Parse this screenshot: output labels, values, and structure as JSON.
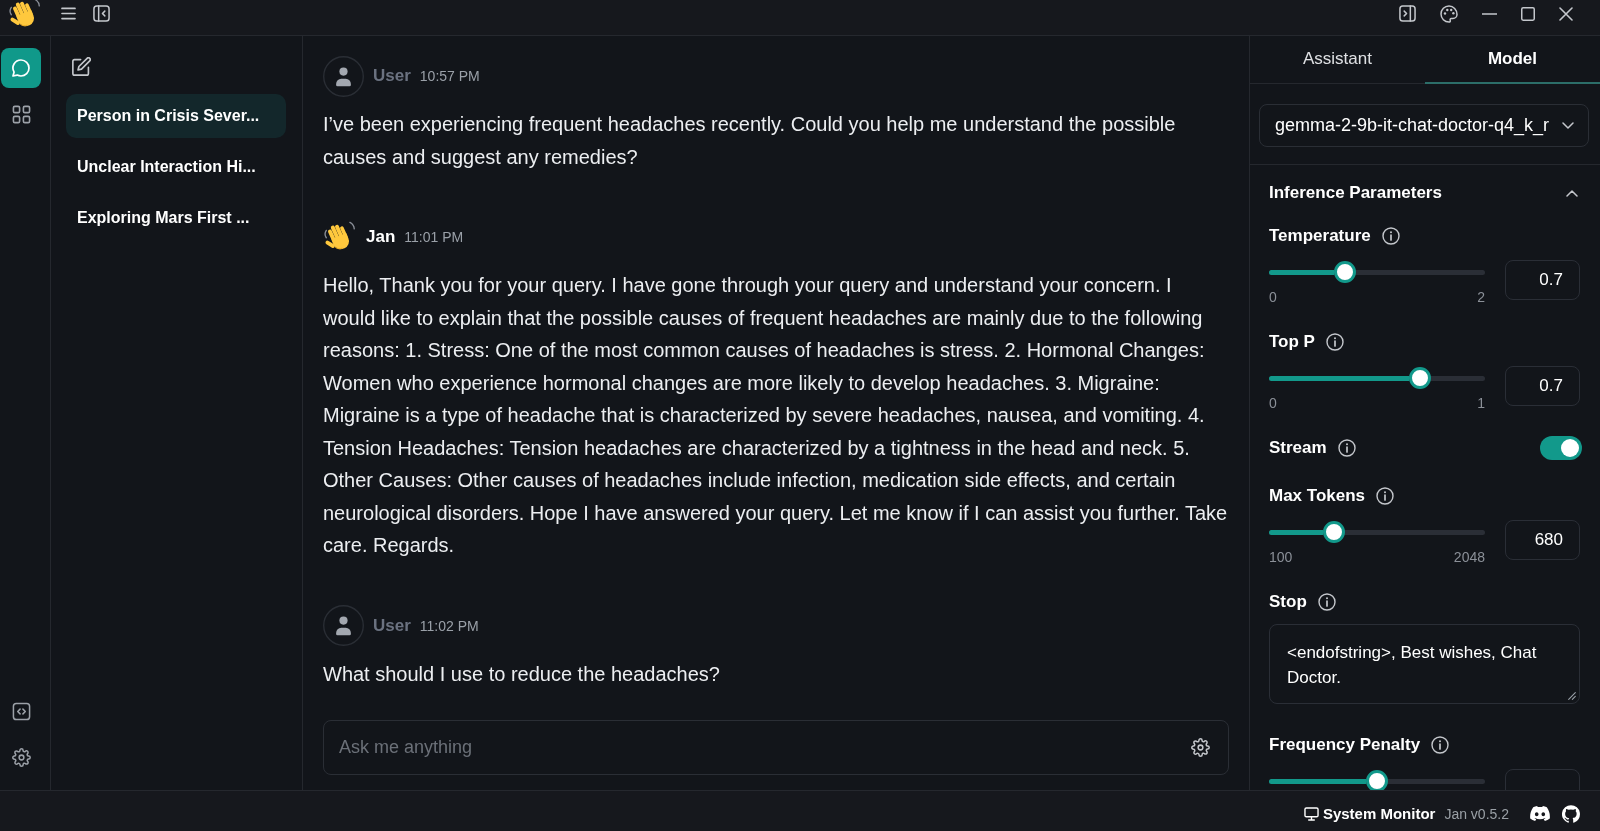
{
  "nav_rail": {
    "items": [
      {
        "kind": "chat",
        "selected": true
      },
      {
        "kind": "hub",
        "selected": false
      }
    ]
  },
  "threads": {
    "items": [
      {
        "title": "Person in Crisis Sever...",
        "selected": true
      },
      {
        "title": "Unclear Interaction Hi...",
        "selected": false
      },
      {
        "title": "Exploring Mars First ...",
        "selected": false
      }
    ]
  },
  "chat": {
    "messages": [
      {
        "kind": "user",
        "author": "User",
        "time": "10:57 PM",
        "text": "I’ve been experiencing frequent headaches recently. Could you help me understand the possible causes and suggest any remedies?"
      },
      {
        "kind": "assistant",
        "author": "Jan",
        "time": "11:01 PM",
        "text": "Hello, Thank you for your query. I have gone through your query and understand your concern. I would like to explain that the possible causes of frequent headaches are mainly due to the following reasons: 1. Stress: One of the most common causes of headaches is stress. 2. Hormonal Changes: Women who experience hormonal changes are more likely to develop headaches. 3. Migraine: Migraine is a type of headache that is characterized by severe headaches, nausea, and vomiting. 4. Tension Headaches: Tension headaches are characterized by a tightness in the head and neck. 5. Other Causes: Other causes of headaches include infection, medication side effects, and certain neurological disorders. Hope I have answered your query. Let me know if I can assist you further. Take care. Regards."
      },
      {
        "kind": "user",
        "author": "User",
        "time": "11:02 PM",
        "text": "What should I use to reduce the headaches?"
      }
    ],
    "composer": {
      "placeholder": "Ask me anything"
    }
  },
  "settings_panel": {
    "tabs": [
      {
        "label": "Assistant",
        "selected": false
      },
      {
        "label": "Model",
        "selected": true
      }
    ],
    "model_select": {
      "value": "gemma-2-9b-it-chat-doctor-q4_k_r"
    },
    "inference": {
      "title": "Inference Parameters",
      "expanded": true,
      "params": [
        {
          "kind": "slider",
          "label": "Temperature",
          "level": 0.35,
          "min": "0",
          "max": "2",
          "value": "0.7"
        },
        {
          "kind": "slider",
          "label": "Top P",
          "level": 0.7,
          "min": "0",
          "max": "1",
          "value": "0.7"
        },
        {
          "kind": "toggle",
          "label": "Stream",
          "on": true
        },
        {
          "kind": "slider",
          "label": "Max Tokens",
          "level": 0.3,
          "min": "100",
          "max": "2048",
          "value": "680"
        },
        {
          "kind": "textarea",
          "label": "Stop",
          "value": "<endofstring>, Best wishes, Chat Doctor."
        },
        {
          "kind": "slider",
          "label": "Frequency Penalty",
          "level": 0.5
        }
      ]
    }
  },
  "status_bar": {
    "monitor_label": "System Monitor",
    "version": "Jan v0.5.2"
  }
}
